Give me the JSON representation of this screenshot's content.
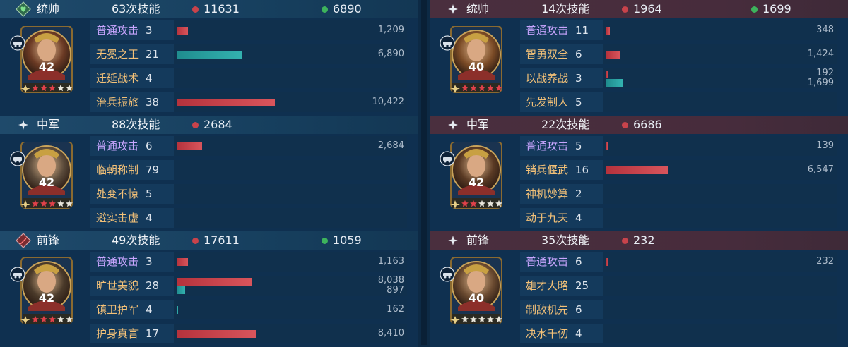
{
  "colors": {
    "red_bar": "#c8434b",
    "green_bar": "#2aa3a3",
    "ally_header": "#1f4a6b",
    "enemy_header": "#4a2f3e",
    "normal_attack_text": "#c9a6ff",
    "skill_text": "#f3c178"
  },
  "left": {
    "blocks": [
      {
        "role": "统帅",
        "role_icon": "heart-shield-icon",
        "casts": "63次技能",
        "red_total": "11631",
        "green_total": "6890",
        "level": "42",
        "stars": 5,
        "stars_lit": 3,
        "skills": [
          {
            "name": "普通攻击",
            "lv": "3",
            "type": "normal",
            "red": 1209,
            "red_label": "1,209"
          },
          {
            "name": "无冕之王",
            "lv": "21",
            "green": 6890,
            "green_label": "6,890"
          },
          {
            "name": "迁延战术",
            "lv": "4"
          },
          {
            "name": "治兵振旅",
            "lv": "38",
            "red": 10422,
            "red_label": "10,422"
          }
        ]
      },
      {
        "role": "中军",
        "role_icon": "sparkle-icon",
        "casts": "88次技能",
        "red_total": "2684",
        "green_total": "",
        "level": "42",
        "stars": 5,
        "stars_lit": 3,
        "skills": [
          {
            "name": "普通攻击",
            "lv": "6",
            "type": "normal",
            "red": 2684,
            "red_label": "2,684"
          },
          {
            "name": "临朝称制",
            "lv": "79"
          },
          {
            "name": "处变不惊",
            "lv": "5"
          },
          {
            "name": "避实击虚",
            "lv": "4"
          }
        ]
      },
      {
        "role": "前锋",
        "role_icon": "sword-shield-icon",
        "casts": "49次技能",
        "red_total": "17611",
        "green_total": "1059",
        "level": "42",
        "stars": 5,
        "stars_lit": 3,
        "skills": [
          {
            "name": "普通攻击",
            "lv": "3",
            "type": "normal",
            "red": 1163,
            "red_label": "1,163"
          },
          {
            "name": "旷世美貌",
            "lv": "28",
            "red": 8038,
            "red_label": "8,038",
            "green": 897,
            "green_label": "897"
          },
          {
            "name": "镇卫护军",
            "lv": "4",
            "green": 162,
            "green_label": "162"
          },
          {
            "name": "护身真言",
            "lv": "17",
            "red": 8410,
            "red_label": "8,410"
          }
        ]
      }
    ]
  },
  "right": {
    "blocks": [
      {
        "role": "统帅",
        "role_icon": "sparkle-icon",
        "casts": "14次技能",
        "red_total": "1964",
        "green_total": "1699",
        "level": "40",
        "stars": 5,
        "stars_lit": 5,
        "skills": [
          {
            "name": "普通攻击",
            "lv": "11",
            "type": "normal",
            "red": 348,
            "red_label": "348"
          },
          {
            "name": "智勇双全",
            "lv": "6",
            "red": 1424,
            "red_label": "1,424"
          },
          {
            "name": "以战养战",
            "lv": "3",
            "red": 192,
            "red_label": "192",
            "green": 1699,
            "green_label": "1,699"
          },
          {
            "name": "先发制人",
            "lv": "5"
          }
        ]
      },
      {
        "role": "中军",
        "role_icon": "sparkle-icon",
        "casts": "22次技能",
        "red_total": "6686",
        "green_total": "",
        "level": "42",
        "stars": 5,
        "stars_lit": 2,
        "skills": [
          {
            "name": "普通攻击",
            "lv": "5",
            "type": "normal",
            "red": 139,
            "red_label": "139"
          },
          {
            "name": "销兵偃武",
            "lv": "16",
            "red": 6547,
            "red_label": "6,547"
          },
          {
            "name": "神机妙算",
            "lv": "2"
          },
          {
            "name": "动于九天",
            "lv": "4"
          }
        ]
      },
      {
        "role": "前锋",
        "role_icon": "sparkle-icon",
        "casts": "35次技能",
        "red_total": "232",
        "green_total": "",
        "level": "40",
        "stars": 5,
        "stars_lit": 0,
        "skills": [
          {
            "name": "普通攻击",
            "lv": "6",
            "type": "normal",
            "red": 232,
            "red_label": "232"
          },
          {
            "name": "雄才大略",
            "lv": "25"
          },
          {
            "name": "制敌机先",
            "lv": "6"
          },
          {
            "name": "决水千仞",
            "lv": "4"
          }
        ]
      }
    ]
  },
  "bar_scale_max": 15000
}
